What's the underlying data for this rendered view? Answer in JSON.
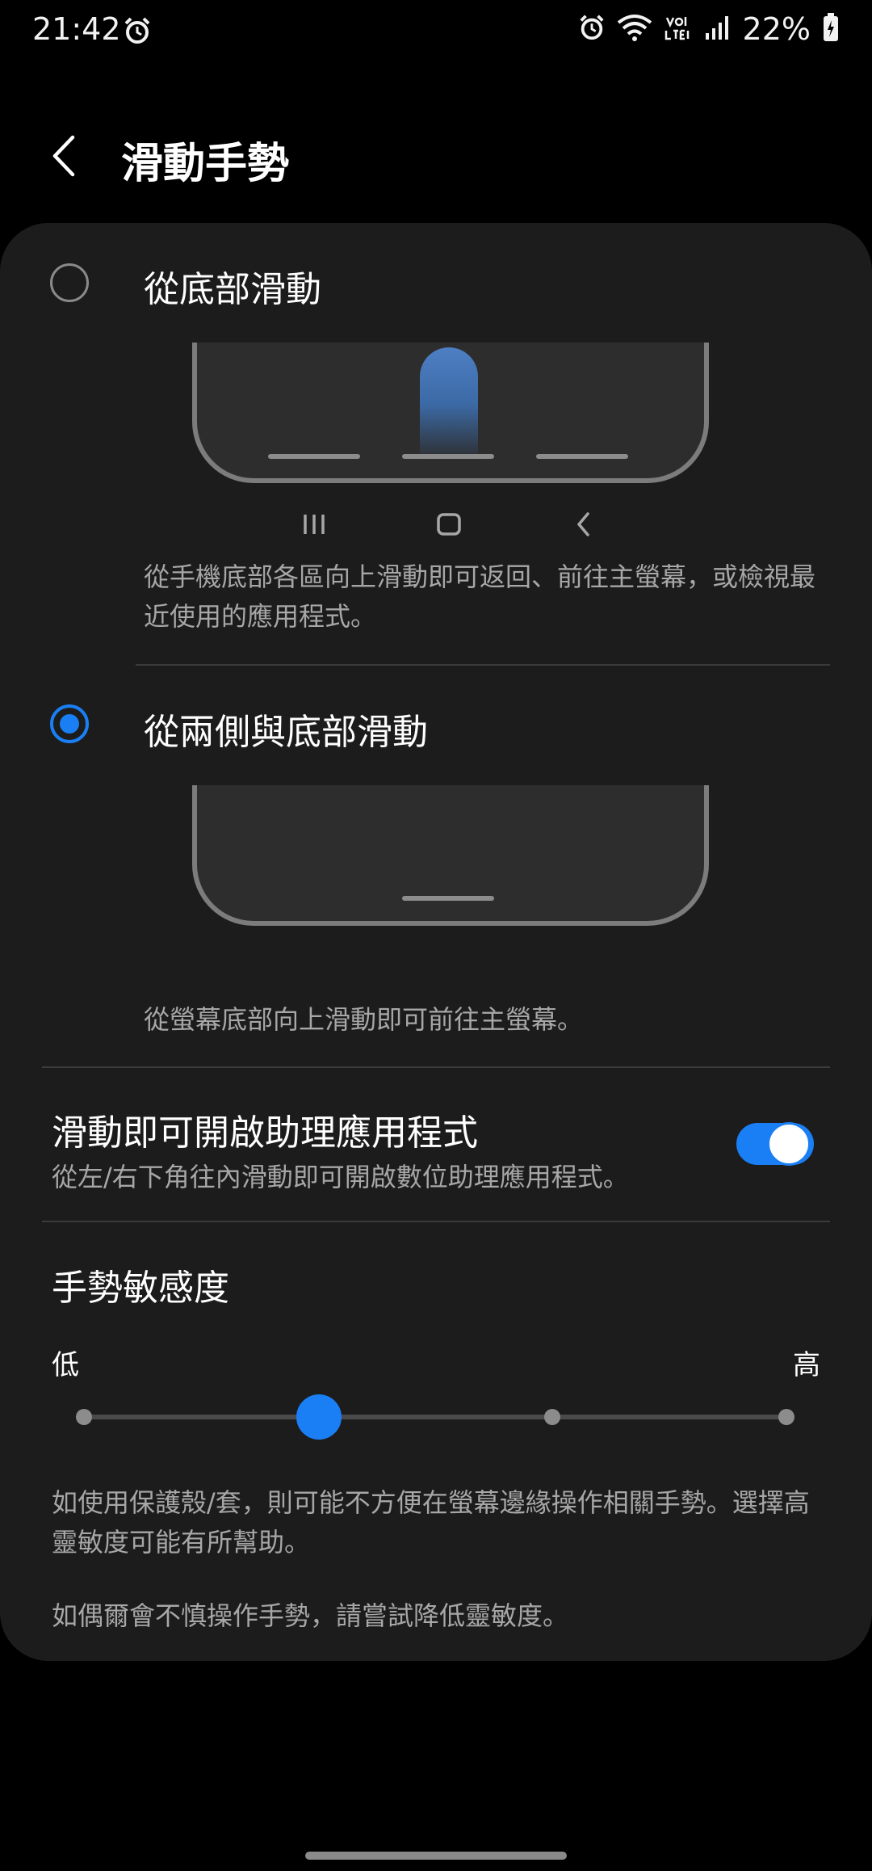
{
  "status_bar": {
    "time": "21:42",
    "battery": "22%"
  },
  "header": {
    "title": "滑動手勢"
  },
  "options": [
    {
      "title": "從底部滑動",
      "description": "從手機底部各區向上滑動即可返回、前往主螢幕，或檢視最近使用的應用程式。",
      "selected": false
    },
    {
      "title": "從兩側與底部滑動",
      "description": "從螢幕底部向上滑動即可前往主螢幕。",
      "selected": true
    }
  ],
  "assistant": {
    "title": "滑動即可開啟助理應用程式",
    "subtitle": "從左/右下角往內滑動即可開啟數位助理應用程式。",
    "enabled": true
  },
  "sensitivity": {
    "title": "手勢敏感度",
    "low_label": "低",
    "high_label": "高",
    "level": 2,
    "levels": 4,
    "note1": "如使用保護殼/套，則可能不方便在螢幕邊緣操作相關手勢。選擇高靈敏度可能有所幫助。",
    "note2": "如偶爾會不慎操作手勢，請嘗試降低靈敏度。"
  },
  "colors": {
    "accent": "#1a7ff5",
    "card": "#1c1c1c",
    "background": "#000000"
  }
}
